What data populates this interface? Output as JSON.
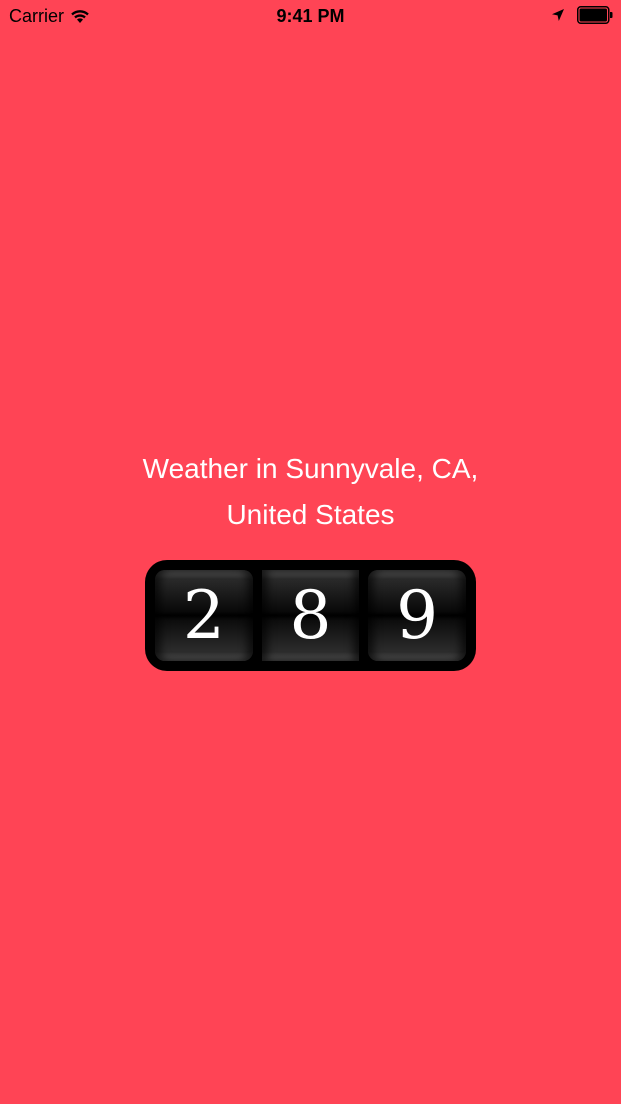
{
  "status_bar": {
    "carrier": "Carrier",
    "time": "9:41 PM",
    "icons": [
      "wifi-icon",
      "location-arrow-icon",
      "battery-icon"
    ]
  },
  "weather": {
    "line1": "Weather in Sunnyvale, CA,",
    "line2": "United States"
  },
  "counter": {
    "digits": [
      "2",
      "8",
      "9"
    ]
  },
  "colors": {
    "background": "#ff4455",
    "text": "#ffffff",
    "counter_frame": "#000000"
  }
}
